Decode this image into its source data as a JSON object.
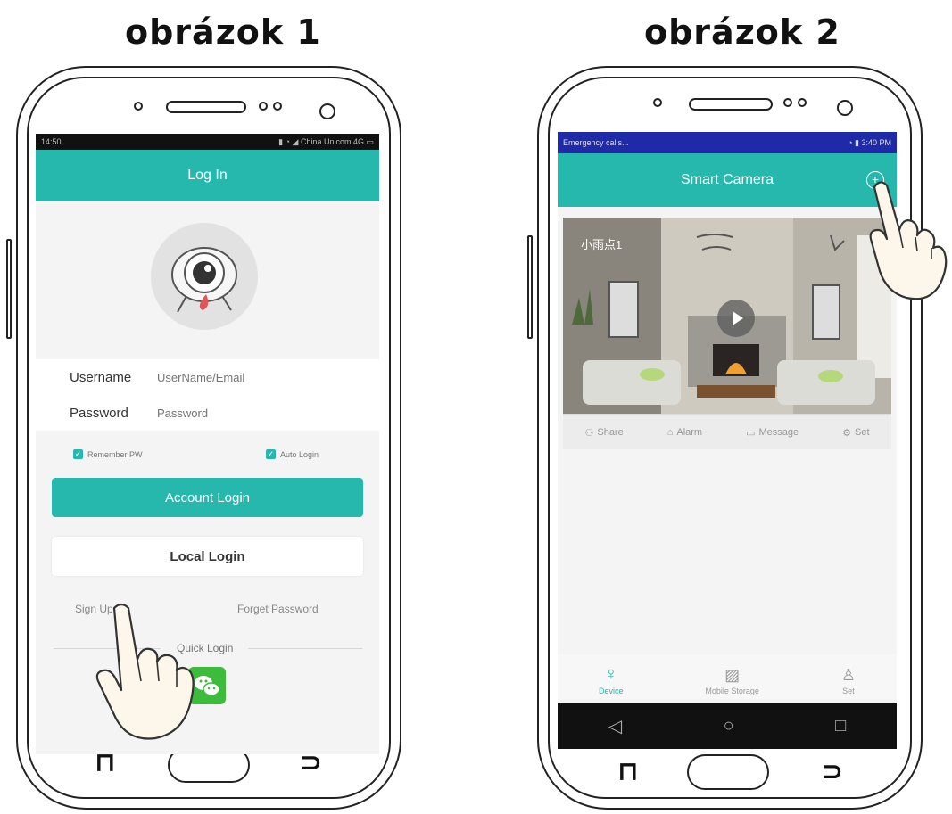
{
  "captions": [
    "obrázok 1",
    "obrázok 2"
  ],
  "colors": {
    "accent": "#26b8ac",
    "wechat": "#3dbb3d",
    "statusbar": "#111111"
  },
  "screen1": {
    "status_time": "14:50",
    "status_right": "China Unicom 4G",
    "title": "Log In",
    "username_label": "Username",
    "username_placeholder": "UserName/Email",
    "password_label": "Password",
    "password_placeholder": "Password",
    "remember_label": "Remember PW",
    "auto_login_label": "Auto Login",
    "account_login": "Account Login",
    "local_login": "Local Login",
    "sign_up": "Sign Up",
    "forget_password": "Forget Password",
    "quick_login": "Quick Login",
    "icons": [
      "avatar-eye-icon",
      "wechat-icon",
      "pointing-hand-icon"
    ]
  },
  "screen2": {
    "status_left": "Emergency calls...",
    "status_right": "3:40 PM",
    "title": "Smart Camera",
    "camera_name": "小雨点1",
    "actions": [
      "Share",
      "Alarm",
      "Message",
      "Set"
    ],
    "tabs": [
      "Device",
      "Mobile Storage",
      "Set"
    ],
    "nav_glyphs": [
      "◁",
      "○",
      "□"
    ],
    "icons": [
      "add-icon",
      "play-icon",
      "share-icon",
      "alarm-icon",
      "message-icon",
      "settings-icon",
      "device-icon",
      "storage-icon",
      "user-icon",
      "pointing-hand-icon"
    ]
  }
}
